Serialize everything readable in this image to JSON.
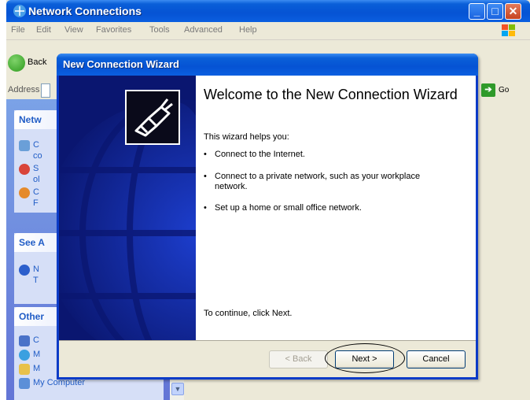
{
  "background_window": {
    "title": "Network Connections",
    "menu": [
      "File",
      "Edit",
      "View",
      "Favorites",
      "Tools",
      "Advanced",
      "Help"
    ],
    "toolbar_back": "Back",
    "address_label": "Address",
    "go_label": "Go",
    "task_pane": {
      "section1_header": "Netw",
      "section1_items": [
        "C",
        "co",
        "S",
        "ol",
        "C",
        "F"
      ],
      "section2_header": "See A",
      "section2_items": [
        "N",
        "T"
      ],
      "section3_header": "Other",
      "section3_items": [
        "C",
        "M",
        "M",
        "My Computer"
      ]
    }
  },
  "wizard": {
    "title": "New Connection Wizard",
    "heading": "Welcome to the New Connection Wizard",
    "intro": "This wizard helps you:",
    "bullets": [
      "Connect to the Internet.",
      "Connect to a private network, such as your workplace network.",
      "Set up a home or small office network."
    ],
    "footer_text": "To continue, click Next.",
    "buttons": {
      "back": "< Back",
      "next": "Next >",
      "cancel": "Cancel"
    }
  }
}
